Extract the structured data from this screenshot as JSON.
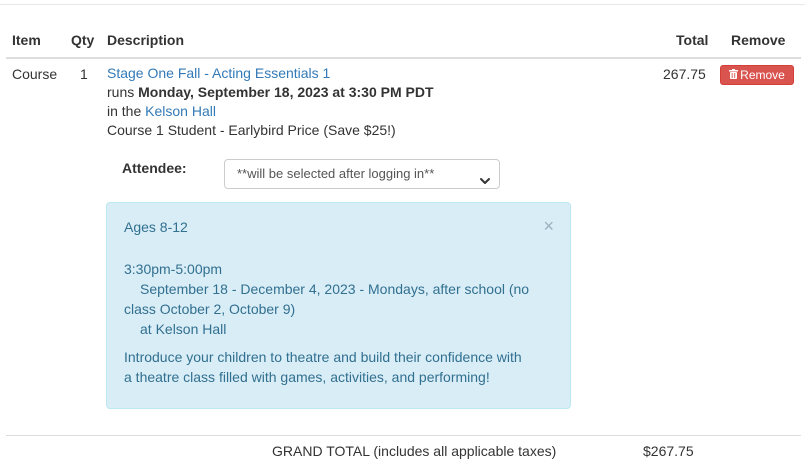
{
  "table": {
    "headers": {
      "item": "Item",
      "qty": "Qty",
      "description": "Description",
      "total": "Total",
      "remove": "Remove"
    }
  },
  "row": {
    "item": "Course",
    "qty": "1",
    "course_title": "Stage One Fall - Acting Essentials 1",
    "runs_prefix": "runs",
    "runs_date": "Monday, September 18, 2023 at 3:30 PM PDT",
    "venue_prefix": "in the",
    "venue": "Kelson Hall",
    "price_desc": "Course 1 Student - Earlybird Price (Save $25!)",
    "total": "267.75",
    "remove_label": "Remove",
    "attendee_label": "Attendee:",
    "attendee_value": "**will be selected after logging in**"
  },
  "info": {
    "ages": "Ages 8-12",
    "time": "3:30pm-5:00pm",
    "dates_line1": "September 18 - December 4, 2023 - Mondays, after school (no",
    "dates_line2": "class October 2, October 9)",
    "location": "at Kelson Hall",
    "desc_line1": "Introduce your children to theatre and build their confidence with",
    "desc_line2": "a theatre class filled with games, activities, and performing!",
    "close": "×"
  },
  "summary": {
    "grand_total_label": "GRAND TOTAL (includes all applicable taxes)",
    "grand_total_value": "$267.75"
  },
  "icons": {
    "remove": "trash-icon",
    "select": "chevron-down-icon",
    "close": "close-icon"
  },
  "colors": {
    "link": "#337ab7",
    "danger": "#d9534f",
    "info_bg": "#d9edf7",
    "info_text": "#31708f"
  }
}
